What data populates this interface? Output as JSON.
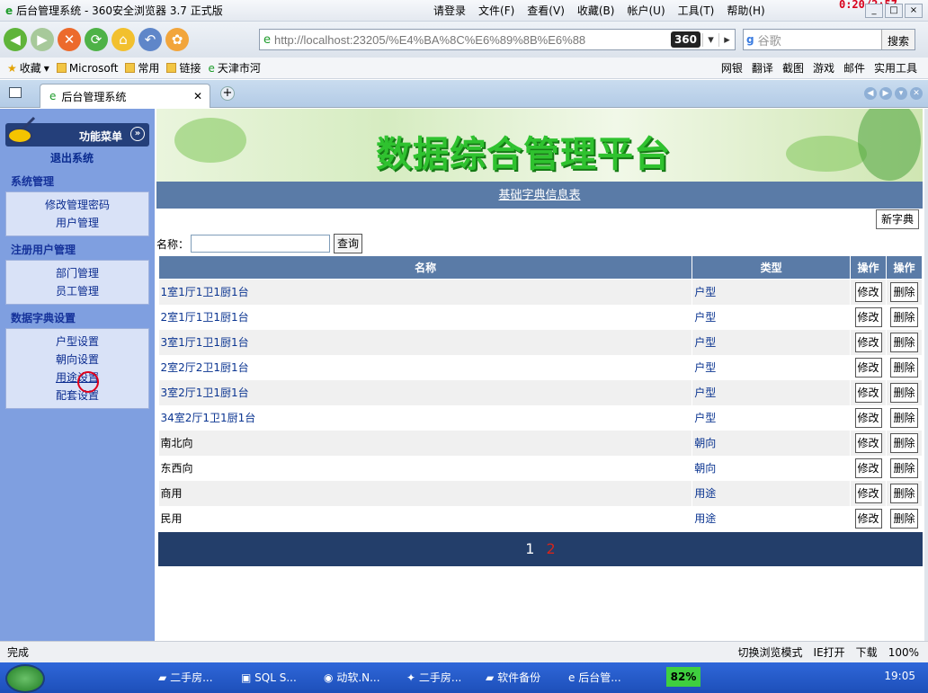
{
  "browser": {
    "window_title": "后台管理系统 - 360安全浏览器 3.7 正式版",
    "timer": "0:20/2:57",
    "login": "请登录",
    "menus": [
      "文件(F)",
      "查看(V)",
      "收藏(B)",
      "帐户(U)",
      "工具(T)",
      "帮助(H)"
    ],
    "address": "http://localhost:23205/%E4%BA%8C%E6%89%8B%E6%88",
    "address_host": "localhost",
    "badge": "360",
    "search_placeholder": "谷歌",
    "search_button": "搜索",
    "favorites": [
      "收藏",
      "Microsoft",
      "常用",
      "链接",
      "天津市河"
    ],
    "toolbar_right": [
      "网银",
      "翻译",
      "截图",
      "游戏",
      "邮件",
      "实用工具"
    ],
    "tab_title": "后台管理系统",
    "status": "完成",
    "status_right": [
      "切换浏览模式",
      "IE打开",
      "下载",
      "100%"
    ]
  },
  "sidebar": {
    "menu_title": "功能菜单",
    "logout": "退出系统",
    "groups": [
      {
        "title": "系统管理",
        "items": [
          "修改管理密码",
          "用户管理"
        ]
      },
      {
        "title": "注册用户管理",
        "items": [
          "部门管理",
          "员工管理"
        ]
      },
      {
        "title": "数据字典设置",
        "items": [
          "户型设置",
          "朝向设置",
          "用途设置",
          "配套设置"
        ]
      }
    ]
  },
  "main": {
    "banner_title": "数据综合管理平台",
    "subtitle": "基础字典信息表",
    "new_button": "新字典",
    "name_label": "名称：",
    "query_button": "查询",
    "columns": [
      "名称",
      "类型",
      "操作",
      "操作"
    ],
    "edit_label": "修改",
    "delete_label": "删除",
    "rows": [
      {
        "name": "1室1厅1卫1厨1台",
        "type": "户型"
      },
      {
        "name": "2室1厅1卫1厨1台",
        "type": "户型"
      },
      {
        "name": "3室1厅1卫1厨1台",
        "type": "户型"
      },
      {
        "name": "2室2厅2卫1厨1台",
        "type": "户型"
      },
      {
        "name": "3室2厅1卫1厨1台",
        "type": "户型"
      },
      {
        "name": "34室2厅1卫1厨1台",
        "type": "户型"
      },
      {
        "name": "南北向",
        "type": "朝向"
      },
      {
        "name": "东西向",
        "type": "朝向"
      },
      {
        "name": "商用",
        "type": "用途"
      },
      {
        "name": "民用",
        "type": "用途"
      }
    ],
    "pages": [
      "1",
      "2"
    ]
  },
  "taskbar": {
    "tasks": [
      "二手房...",
      "SQL S...",
      "动软.N...",
      "二手房...",
      "软件备份",
      "后台管..."
    ],
    "battery": "82%",
    "clock": "19:05"
  }
}
